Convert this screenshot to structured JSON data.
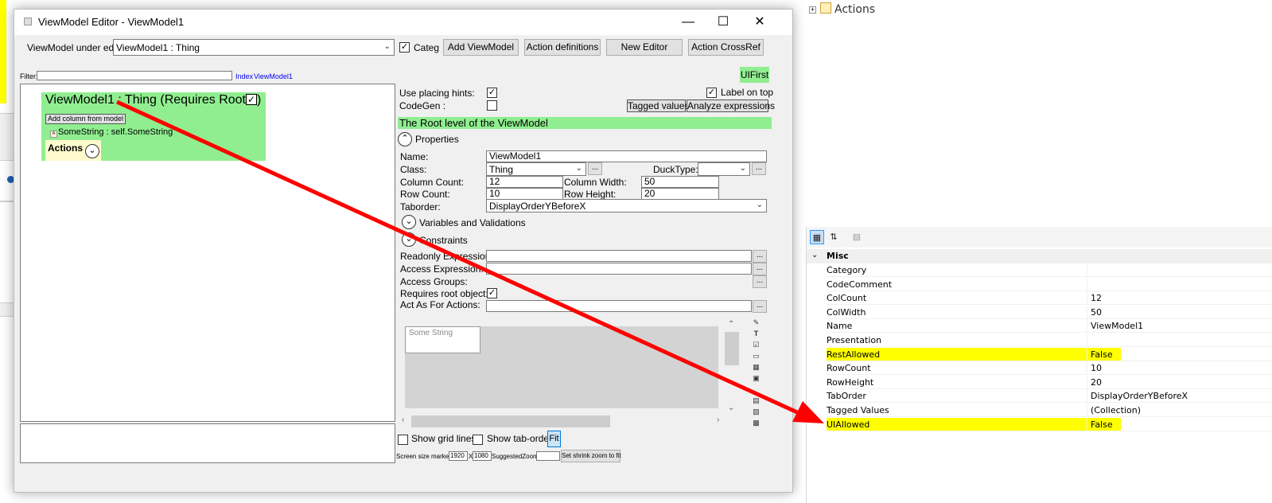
{
  "dialog": {
    "title": "ViewModel Editor - ViewModel1",
    "vm_under_edit_label": "ViewModel under edit:",
    "vm_under_edit_value": "ViewModel1 : Thing",
    "categ_label": "Categ",
    "buttons": {
      "add_viewmodel": "Add ViewModel",
      "action_definitions": "Action definitions",
      "new_editor": "New Editor",
      "action_crossref": "Action CrossRef"
    },
    "filter_label": "Filter:",
    "index_link": "Index",
    "viewmodel_link": "ViewModel1",
    "ui_first": "UIFirst"
  },
  "canvas": {
    "vm_title": "ViewModel1 : Thing  (Requires Root",
    "vm_title_end": ")",
    "add_column_button": "Add column from model",
    "attribute": "SomeString : self.SomeString",
    "actions_label": "Actions"
  },
  "props": {
    "use_placing_hints": "Use placing hints:",
    "codegen": "CodeGen :",
    "label_on_top": "Label on top",
    "tagged_values_btn": "Tagged values",
    "analyze_expressions_btn": "Analyze expressions",
    "root_level": "The Root level of the ViewModel",
    "properties_header": "Properties",
    "name_label": "Name:",
    "name_value": "ViewModel1",
    "class_label": "Class:",
    "class_value": "Thing",
    "ducktype_label": "DuckType:",
    "column_count_label": "Column Count:",
    "column_count_value": "12",
    "column_width_label": "Column Width:",
    "column_width_value": "50",
    "row_count_label": "Row Count:",
    "row_count_value": "10",
    "row_height_label": "Row Height:",
    "row_height_value": "20",
    "taborder_label": "Taborder:",
    "taborder_value": "DisplayOrderYBeforeX",
    "variables_header": "Variables and Validations",
    "constraints_header": "Constraints",
    "readonly_label": "Readonly Expression:",
    "access_expr_label": "Access Expression:",
    "access_groups_label": "Access Groups:",
    "requires_root_label": "Requires root object:",
    "act_as_label": "Act As For Actions:",
    "dots": "...",
    "preview_field": "Some String"
  },
  "footer": {
    "show_grid_lines": "Show grid lines",
    "show_tab_order": "Show tab-order",
    "fit": "Fit",
    "screen_size_marker": "Screen size marker",
    "width": "1920",
    "x": "X",
    "height": "1080",
    "suggested_zoom": "SuggestedZoom",
    "set_shrink": "Set shrink zoom to fit"
  },
  "tree": {
    "actions_node": "Actions"
  },
  "property_grid": {
    "category": "Misc",
    "rows": [
      {
        "name": "Category",
        "value": ""
      },
      {
        "name": "CodeComment",
        "value": ""
      },
      {
        "name": "ColCount",
        "value": "12"
      },
      {
        "name": "ColWidth",
        "value": "50"
      },
      {
        "name": "Name",
        "value": "ViewModel1"
      },
      {
        "name": "Presentation",
        "value": ""
      },
      {
        "name": "RestAllowed",
        "value": "False",
        "highlight": true
      },
      {
        "name": "RowCount",
        "value": "10"
      },
      {
        "name": "RowHeight",
        "value": "20"
      },
      {
        "name": "TabOrder",
        "value": "DisplayOrderYBeforeX"
      },
      {
        "name": "Tagged Values",
        "value": "(Collection)"
      },
      {
        "name": "UIAllowed",
        "value": "False",
        "highlight": true
      }
    ]
  },
  "colors": {
    "highlight": "#ffff00",
    "green": "#90ee90",
    "arrow": "#ff0000"
  }
}
